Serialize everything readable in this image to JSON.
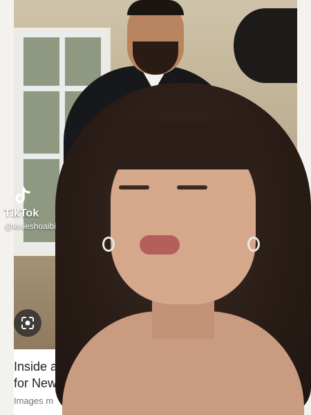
{
  "result": {
    "title_line1": "Inside a",
    "title_line2": "for New",
    "source": "Images m"
  },
  "tiktok": {
    "brand": "TikTok",
    "handle": "@lexieshoaibi"
  },
  "lens_button": {
    "icon": "lens-icon"
  },
  "colors": {
    "card_bg": "#ffffff",
    "title_text": "#1f1f1f",
    "source_text": "#70757a"
  }
}
